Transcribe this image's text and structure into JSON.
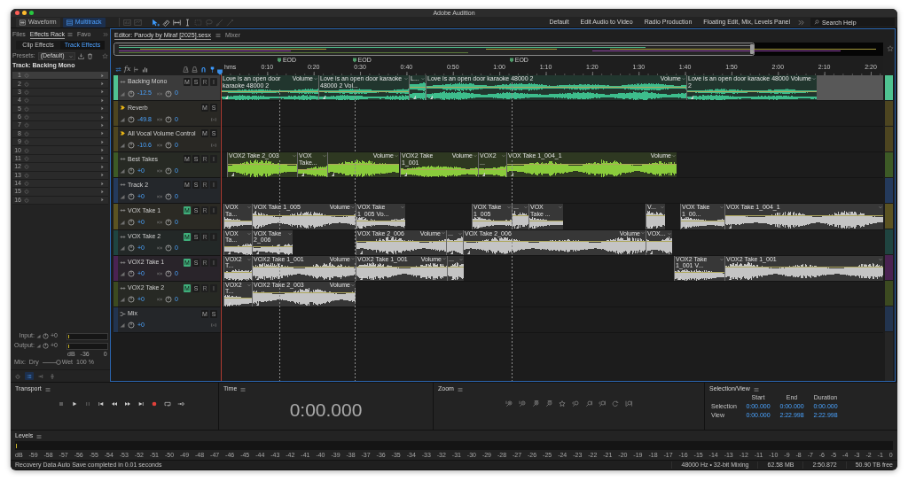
{
  "window": {
    "title": "Adobe Audition"
  },
  "toolbar": {
    "views": [
      {
        "kind": "waveform",
        "label": "Waveform",
        "selected": false
      },
      {
        "kind": "multitrack",
        "label": "Multitrack",
        "selected": true
      }
    ],
    "tools": [
      {
        "kind": "spectral",
        "selected": false,
        "disabled": true
      },
      {
        "kind": "pitch",
        "selected": false,
        "disabled": true
      },
      {
        "kind": "move",
        "selected": true,
        "disabled": false
      },
      {
        "kind": "razor",
        "selected": false,
        "disabled": false
      },
      {
        "kind": "slip",
        "selected": false,
        "disabled": false
      },
      {
        "kind": "time-selection",
        "selected": false,
        "disabled": false
      },
      {
        "kind": "marquee",
        "selected": false,
        "disabled": true
      },
      {
        "kind": "lasso",
        "selected": false,
        "disabled": true
      },
      {
        "kind": "brush",
        "selected": false,
        "disabled": true
      },
      {
        "kind": "healing",
        "selected": false,
        "disabled": true
      }
    ],
    "workspaces": [
      "Default",
      "Edit Audio to Video",
      "Radio Production",
      "Floating Edit, Mix, Levels Panel"
    ],
    "search": {
      "placeholder": "Search Help"
    }
  },
  "left_panel": {
    "tabs": [
      {
        "label": "Files",
        "selected": false
      },
      {
        "label": "Effects Rack",
        "selected": true
      },
      {
        "label": "Favo",
        "selected": false
      }
    ],
    "modes": [
      {
        "label": "Clip Effects",
        "selected": false
      },
      {
        "label": "Track Effects",
        "selected": true
      }
    ],
    "presets": {
      "label": "Presets:",
      "value": "(Default)"
    },
    "track": "Track: Backing Mono",
    "slots": [
      {
        "number": "1",
        "selected": true
      },
      {
        "number": "2",
        "selected": false
      },
      {
        "number": "3",
        "selected": false
      },
      {
        "number": "4",
        "selected": false
      },
      {
        "number": "5",
        "selected": false
      },
      {
        "number": "6",
        "selected": false
      },
      {
        "number": "7",
        "selected": false
      },
      {
        "number": "8",
        "selected": false
      },
      {
        "number": "9",
        "selected": false
      },
      {
        "number": "10",
        "selected": false
      },
      {
        "number": "11",
        "selected": false
      },
      {
        "number": "12",
        "selected": false
      },
      {
        "number": "13",
        "selected": false
      },
      {
        "number": "14",
        "selected": false
      },
      {
        "number": "15",
        "selected": false
      },
      {
        "number": "16",
        "selected": false
      }
    ],
    "input": {
      "label": "Input:",
      "value": "+0"
    },
    "output": {
      "label": "Output:",
      "value": "+0"
    },
    "scale": [
      "dB",
      "-36",
      "0"
    ],
    "mix": {
      "label": "Mix:",
      "dry": "Dry",
      "wet": "Wet",
      "value": "100 %",
      "level": 1
    },
    "footer": [
      {
        "kind": "power",
        "selected": false
      },
      {
        "kind": "list",
        "selected": true
      },
      {
        "kind": "insert",
        "selected": false
      },
      {
        "kind": "route",
        "selected": false
      }
    ]
  },
  "editor": {
    "tabs": [
      {
        "label": "Editor: Parody by Miraf [2025].sesx",
        "selected": true
      },
      {
        "label": "Mixer",
        "selected": false
      }
    ],
    "header_tools": [
      {
        "kind": "io",
        "on": true
      },
      {
        "kind": "fx",
        "label": "fx",
        "on": false
      },
      {
        "kind": "sends",
        "on": false
      },
      {
        "kind": "eq",
        "on": false
      },
      {
        "kind": "metronome",
        "on": false
      },
      {
        "kind": "click",
        "on": false
      },
      {
        "kind": "snap",
        "on": true
      },
      {
        "kind": "marker",
        "on": true
      }
    ],
    "ruler": {
      "labels": [
        "hms",
        "0:10",
        "0:20",
        "0:30",
        "0:40",
        "0:50",
        "1:00",
        "1:10",
        "1:20",
        "1:30",
        "1:40",
        "1:50",
        "2:00",
        "2:10",
        "2:20"
      ],
      "markers": [
        "EOD",
        "EOD",
        "EOD"
      ]
    },
    "tracks": [
      {
        "name": "Backing Mono",
        "kind": "audio",
        "color": "#4fc391",
        "selected": true,
        "buttons": [
          {
            "kind": "mute",
            "label": "M",
            "on": false
          },
          {
            "kind": "solo",
            "label": "S",
            "on": false
          },
          {
            "kind": "arm",
            "label": "R",
            "on": false
          },
          {
            "kind": "monitor",
            "label": "I",
            "on": false
          }
        ],
        "volume": "-12.5",
        "pan": "0",
        "stereo": true,
        "clips": [
          {
            "name": "Love is an open door karaoke 48000 2",
            "volume": "Volume",
            "color": "#3dbd8c"
          },
          {
            "name": "Love is an open door karaoke 48000 2 Vol...",
            "color": "#3dbd8c"
          },
          {
            "name": "L...",
            "color": "#3dbd8c"
          },
          {
            "name": "Love is an open door karaoke 48000 2",
            "volume": "Volume",
            "color": "#3dbd8c"
          },
          {
            "name": "Love is an open door karaoke 48000 2",
            "volume": "Volume",
            "color": "#3dbd8c"
          }
        ]
      },
      {
        "name": "Reverb",
        "kind": "bus",
        "color": "#4d4520",
        "selected": false,
        "buttons": [
          {
            "kind": "mute",
            "label": "M",
            "on": false
          },
          {
            "kind": "solo",
            "label": "S",
            "on": false
          }
        ],
        "volume": "-49.8",
        "pan": "0"
      },
      {
        "name": "All Vocal Volume Control",
        "kind": "bus",
        "color": "#4d4520",
        "selected": false,
        "buttons": [
          {
            "kind": "mute",
            "label": "M",
            "on": false
          },
          {
            "kind": "solo",
            "label": "S",
            "on": false
          }
        ],
        "volume": "-10.6",
        "pan": "0"
      },
      {
        "name": "Best Takes",
        "kind": "audio",
        "color": "#3d5a26",
        "selected": false,
        "buttons": [
          {
            "kind": "mute",
            "label": "M",
            "on": false
          },
          {
            "kind": "solo",
            "label": "S",
            "on": false
          },
          {
            "kind": "arm",
            "label": "R",
            "on": false
          },
          {
            "kind": "monitor",
            "label": "I",
            "on": false
          }
        ],
        "volume": "+0",
        "pan": "0",
        "stereo": false,
        "clips": [
          {
            "name": "VOX2 Take 2_003",
            "color": "#8acb3c"
          },
          {
            "name": "VOX Take...",
            "color": "#8acb3c"
          },
          {
            "volume": "Volume",
            "color": "#8acb3c"
          },
          {
            "name": "VOX2 Take 1_001",
            "volume": "Volume",
            "color": "#8acb3c"
          },
          {
            "name": "VOX2 ...",
            "color": "#8acb3c"
          },
          {
            "name": "VOX Take 1_004_1",
            "volume": "Volume",
            "color": "#8acb3c"
          }
        ]
      },
      {
        "name": "Track 2",
        "kind": "audio",
        "color": "#243a5c",
        "selected": false,
        "buttons": [
          {
            "kind": "mute",
            "label": "M",
            "on": false
          },
          {
            "kind": "solo",
            "label": "S",
            "on": false
          },
          {
            "kind": "arm",
            "label": "R",
            "on": false
          },
          {
            "kind": "monitor",
            "label": "I",
            "on": false
          }
        ],
        "volume": "+0",
        "pan": "0"
      },
      {
        "name": "VOX Take 1",
        "kind": "audio",
        "color": "#5b5322",
        "selected": false,
        "buttons": [
          {
            "kind": "mute",
            "label": "M",
            "on": true
          },
          {
            "kind": "solo",
            "label": "S",
            "on": false
          },
          {
            "kind": "arm",
            "label": "R",
            "on": false
          },
          {
            "kind": "monitor",
            "label": "I",
            "on": false
          }
        ],
        "volume": "+0",
        "pan": "0",
        "stereo": false,
        "clips": [
          {
            "name": "VOX Ta...",
            "color": "#c4c4c4"
          },
          {
            "name": "VOX Take 1_005",
            "volume": "Volume",
            "color": "#c4c4c4"
          },
          {
            "name": "VOX Take 1_005 Vo...",
            "color": "#c4c4c4"
          },
          {
            "name": "VOX Take 1_005",
            "color": "#c4c4c4"
          },
          {
            "name": "...",
            "color": "#c4c4c4"
          },
          {
            "name": "VOX Take ...",
            "color": "#c4c4c4"
          },
          {
            "name": "V...",
            "color": "#c4c4c4"
          },
          {
            "name": "VOX Take 1_00...",
            "color": "#c4c4c4"
          },
          {
            "name": "VOX Take 1_004_1",
            "color": "#c4c4c4"
          }
        ]
      },
      {
        "name": "VOX Take 2",
        "kind": "audio",
        "color": "#1f4440",
        "selected": false,
        "buttons": [
          {
            "kind": "mute",
            "label": "M",
            "on": true
          },
          {
            "kind": "solo",
            "label": "S",
            "on": false
          },
          {
            "kind": "arm",
            "label": "R",
            "on": false
          },
          {
            "kind": "monitor",
            "label": "I",
            "on": false
          }
        ],
        "volume": "+0",
        "pan": "0",
        "stereo": false,
        "clips": [
          {
            "name": "VOX Ta...",
            "color": "#c4c4c4"
          },
          {
            "name": "VOX Take 2_006",
            "color": "#c4c4c4"
          },
          {
            "name": "VOX Take 2_006",
            "volume": "Volume",
            "color": "#c4c4c4"
          },
          {
            "name": "...",
            "color": "#c4c4c4"
          },
          {
            "name": "VOX Take 2_006",
            "volume": "Volume",
            "color": "#c4c4c4"
          },
          {
            "name": "VOX...",
            "color": "#c4c4c4"
          }
        ]
      },
      {
        "name": "VOX2 Take 1",
        "kind": "audio",
        "color": "#4a2352",
        "selected": false,
        "buttons": [
          {
            "kind": "mute",
            "label": "M",
            "on": true
          },
          {
            "kind": "solo",
            "label": "S",
            "on": false
          },
          {
            "kind": "arm",
            "label": "R",
            "on": false
          },
          {
            "kind": "monitor",
            "label": "I",
            "on": false
          }
        ],
        "volume": "+0",
        "pan": "0",
        "stereo": false,
        "clips": [
          {
            "name": "VOX2 T...",
            "color": "#c4c4c4"
          },
          {
            "name": "VOX2 Take 1_001",
            "volume": "Volume",
            "color": "#c4c4c4"
          },
          {
            "name": "VOX2 Take 1_001",
            "volume": "Volume",
            "color": "#c4c4c4"
          },
          {
            "name": "...",
            "color": "#c4c4c4"
          },
          {
            "name": "VOX2 Take 1_001 V...",
            "color": "#c4c4c4"
          },
          {
            "name": "VOX2 Take 1_001",
            "color": "#c4c4c4"
          }
        ]
      },
      {
        "name": "VOX2 Take 2",
        "kind": "audio",
        "color": "#3c4a20",
        "selected": false,
        "buttons": [
          {
            "kind": "mute",
            "label": "M",
            "on": true
          },
          {
            "kind": "solo",
            "label": "S",
            "on": false
          },
          {
            "kind": "arm",
            "label": "R",
            "on": false
          },
          {
            "kind": "monitor",
            "label": "I",
            "on": false
          }
        ],
        "volume": "+0",
        "pan": "0",
        "stereo": false,
        "clips": [
          {
            "name": "VOX2 T...",
            "color": "#c4c4c4"
          },
          {
            "name": "VOX2 Take 2_003",
            "volume": "Volume",
            "color": "#c4c4c4"
          }
        ]
      },
      {
        "name": "Mix",
        "kind": "mix",
        "color": "#22344f",
        "selected": false,
        "buttons": [
          {
            "kind": "mute",
            "label": "M",
            "on": false
          },
          {
            "kind": "solo",
            "label": "S",
            "on": false
          }
        ],
        "volume": "+0"
      }
    ]
  },
  "transport": {
    "title": "Transport",
    "buttons": [
      {
        "kind": "stop",
        "disabled": true
      },
      {
        "kind": "play",
        "disabled": false
      },
      {
        "kind": "pause",
        "disabled": true
      },
      {
        "kind": "to-start",
        "disabled": false
      },
      {
        "kind": "rewind",
        "disabled": false
      },
      {
        "kind": "forward",
        "disabled": false
      },
      {
        "kind": "to-end",
        "disabled": false
      },
      {
        "kind": "record",
        "disabled": false
      },
      {
        "kind": "loop",
        "disabled": false
      },
      {
        "kind": "skip",
        "disabled": false
      }
    ]
  },
  "time": {
    "title": "Time",
    "value": "0:00.000"
  },
  "zoom": {
    "title": "Zoom",
    "buttons": [
      {
        "kind": "zoom-in-amplitude"
      },
      {
        "kind": "zoom-out-amplitude"
      },
      {
        "kind": "zoom-in-time"
      },
      {
        "kind": "zoom-out-time"
      },
      {
        "kind": "zoom-full"
      },
      {
        "kind": "zoom-in-start"
      },
      {
        "kind": "zoom-in-end"
      },
      {
        "kind": "zoom-selection"
      },
      {
        "kind": "zoom-reset"
      },
      {
        "kind": "zoom-tracks"
      }
    ]
  },
  "selection_view": {
    "title": "Selection/View",
    "columns": [
      "Start",
      "End",
      "Duration"
    ],
    "rows": [
      {
        "label": "Selection",
        "values": [
          "0:00.000",
          "0:00.000",
          "0:00.000"
        ]
      },
      {
        "label": "View",
        "values": [
          "0:00.000",
          "2:22.998",
          "2:22.998"
        ]
      }
    ]
  },
  "levels": {
    "title": "Levels",
    "scale": [
      "dB",
      "-59",
      "-58",
      "-57",
      "-56",
      "-55",
      "-54",
      "-53",
      "-52",
      "-51",
      "-50",
      "-49",
      "-48",
      "-47",
      "-46",
      "-45",
      "-44",
      "-43",
      "-42",
      "-41",
      "-40",
      "-39",
      "-38",
      "-37",
      "-36",
      "-35",
      "-34",
      "-33",
      "-32",
      "-31",
      "-30",
      "-29",
      "-28",
      "-27",
      "-26",
      "-25",
      "-24",
      "-23",
      "-22",
      "-21",
      "-20",
      "-19",
      "-18",
      "-17",
      "-16",
      "-15",
      "-14",
      "-13",
      "-12",
      "-11",
      "-10",
      "-9",
      "-8",
      "-7",
      "-6",
      "-5",
      "-4",
      "-3",
      "-2",
      "-1",
      "0"
    ]
  },
  "status_bar": {
    "message": "Recovery Data Auto Save completed in 0.01 seconds",
    "items": [
      "48000 Hz • 32-bit Mixing",
      "62.58 MB",
      "2:50.872",
      "50.90 TB free"
    ]
  }
}
